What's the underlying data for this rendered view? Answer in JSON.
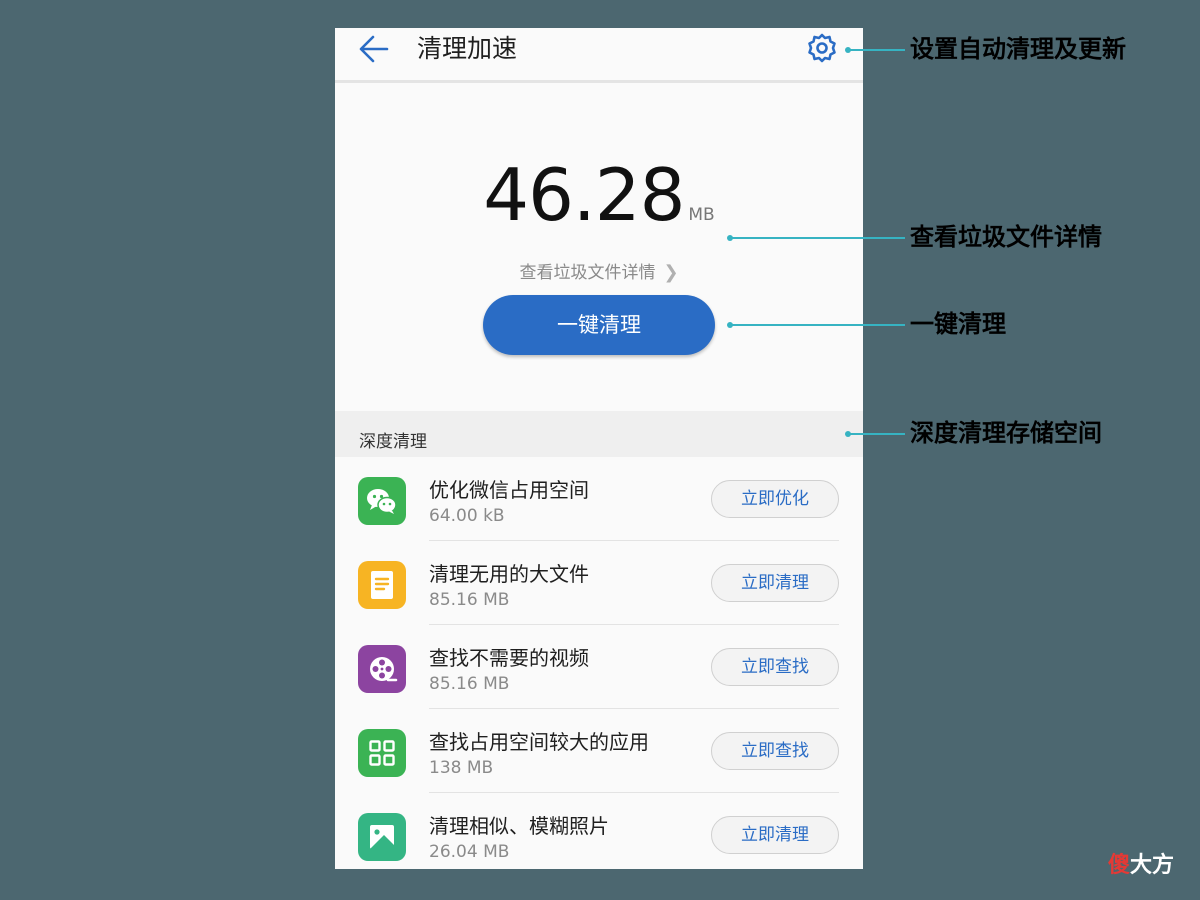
{
  "header": {
    "title": "清理加速",
    "back_icon": "arrow-left-icon",
    "settings_icon": "gear-icon"
  },
  "summary": {
    "amount": "46.28",
    "unit": "MB",
    "detail_link": "查看垃圾文件详情",
    "primary_button": "一键清理"
  },
  "deep_clean": {
    "section_title": "深度清理",
    "items": [
      {
        "title": "优化微信占用空间",
        "size": "64.00 kB",
        "action": "立即优化",
        "icon": "wechat-icon",
        "icon_color": "#3bb354"
      },
      {
        "title": "清理无用的大文件",
        "size": "85.16 MB",
        "action": "立即清理",
        "icon": "document-icon",
        "icon_color": "#f7b423"
      },
      {
        "title": "查找不需要的视频",
        "size": "85.16 MB",
        "action": "立即查找",
        "icon": "film-reel-icon",
        "icon_color": "#8c44a0"
      },
      {
        "title": "查找占用空间较大的应用",
        "size": "138 MB",
        "action": "立即查找",
        "icon": "app-grid-icon",
        "icon_color": "#3bb354"
      },
      {
        "title": "清理相似、模糊照片",
        "size": "26.04 MB",
        "action": "立即清理",
        "icon": "photo-icon",
        "icon_color": "#34b584"
      }
    ]
  },
  "callouts": {
    "settings": "设置自动清理及更新",
    "details": "查看垃圾文件详情",
    "one_key": "一键清理",
    "deep": "深度清理存储空间"
  },
  "watermark": {
    "first": "傻",
    "rest": "大方"
  },
  "colors": {
    "accent": "#2a6cc5",
    "callout": "#36b3c2",
    "background": "#4c6770"
  }
}
